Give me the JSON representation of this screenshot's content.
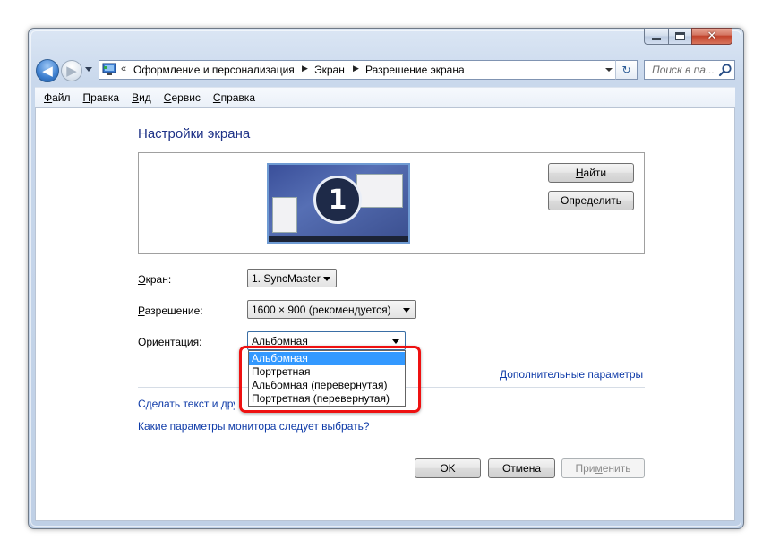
{
  "window": {
    "caption_buttons": {
      "minimize_icon": "minimize-icon",
      "maximize_icon": "maximize-icon",
      "close_glyph": "✕"
    }
  },
  "nav": {
    "back_icon": "back-arrow-icon",
    "forward_icon": "forward-arrow-icon",
    "breadcrumb": {
      "overflow": "«",
      "items": [
        "Оформление и персонализация",
        "Экран",
        "Разрешение экрана"
      ],
      "separator": "▶"
    },
    "refresh_glyph": "↻"
  },
  "search": {
    "placeholder": "Поиск в па..."
  },
  "menu": {
    "items": [
      {
        "label": "Файл",
        "accel": "Ф",
        "rest": "айл"
      },
      {
        "label": "Правка",
        "accel": "П",
        "rest": "равка"
      },
      {
        "label": "Вид",
        "accel": "В",
        "rest": "ид"
      },
      {
        "label": "Сервис",
        "accel": "С",
        "rest": "ервис"
      },
      {
        "label": "Справка",
        "accel": "С",
        "rest": "правка"
      }
    ]
  },
  "page": {
    "title": "Настройки экрана",
    "monitor_number": "1",
    "find_button": {
      "pre": "",
      "accel": "Н",
      "post": "айти"
    },
    "identify_button": {
      "pre": "Опре",
      "accel": "д",
      "post": "елить"
    },
    "screen_label": {
      "accel": "Э",
      "rest": "кран:"
    },
    "screen_value": "1. SyncMaster",
    "resolution_label": {
      "accel": "Р",
      "rest": "азрешение:"
    },
    "resolution_value": "1600 × 900 (рекомендуется)",
    "orientation_label": {
      "accel": "О",
      "rest": "риентация:"
    },
    "orientation_value": "Альбомная",
    "orientation_options": [
      "Альбомная",
      "Портретная",
      "Альбомная (перевернутая)",
      "Портретная (перевернутая)"
    ],
    "orientation_selected_index": 0,
    "advanced_link": "Дополнительные параметры",
    "text_size_link": "Сделать текст и другие элементы больше или меньше",
    "monitor_help_link": "Какие параметры монитора следует выбрать?"
  },
  "footer": {
    "ok_label": "OK",
    "cancel_label": "Отмена",
    "apply_button": {
      "pre": "При",
      "accel": "м",
      "post": "енить"
    },
    "apply_enabled": false
  },
  "colors": {
    "link": "#0f3ba8",
    "title": "#1e3287",
    "highlight": "#ee1111",
    "selection": "#3399ff"
  }
}
